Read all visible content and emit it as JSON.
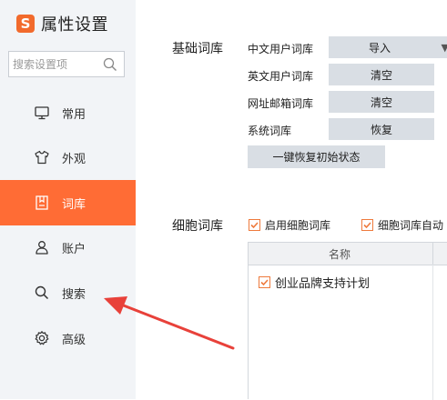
{
  "app": {
    "title": "属性设置",
    "logo_glyph": "S",
    "accent": "#ff6c35"
  },
  "search": {
    "placeholder": "搜索设置项"
  },
  "nav": [
    {
      "label": "常用",
      "icon": "monitor-icon",
      "active": false
    },
    {
      "label": "外观",
      "icon": "tshirt-icon",
      "active": false
    },
    {
      "label": "词库",
      "icon": "book-icon",
      "active": true
    },
    {
      "label": "账户",
      "icon": "user-icon",
      "active": false
    },
    {
      "label": "搜索",
      "icon": "search-icon",
      "active": false
    },
    {
      "label": "高级",
      "icon": "gear-icon",
      "active": false
    }
  ],
  "basic_lexicon": {
    "section_label": "基础词库",
    "rows": [
      {
        "label": "中文用户词库",
        "button": "导入"
      },
      {
        "label": "英文用户词库",
        "button": "清空"
      },
      {
        "label": "网址邮箱词库",
        "button": "清空"
      },
      {
        "label": "系统词库",
        "button": "恢复"
      }
    ],
    "restore_all": "一键恢复初始状态"
  },
  "cell_lexicon": {
    "section_label": "细胞词库",
    "enable": "启用细胞词库",
    "auto": "细胞词库自动",
    "column_header": "名称",
    "items": [
      {
        "name": "创业品牌支持计划",
        "checked": true
      }
    ]
  }
}
